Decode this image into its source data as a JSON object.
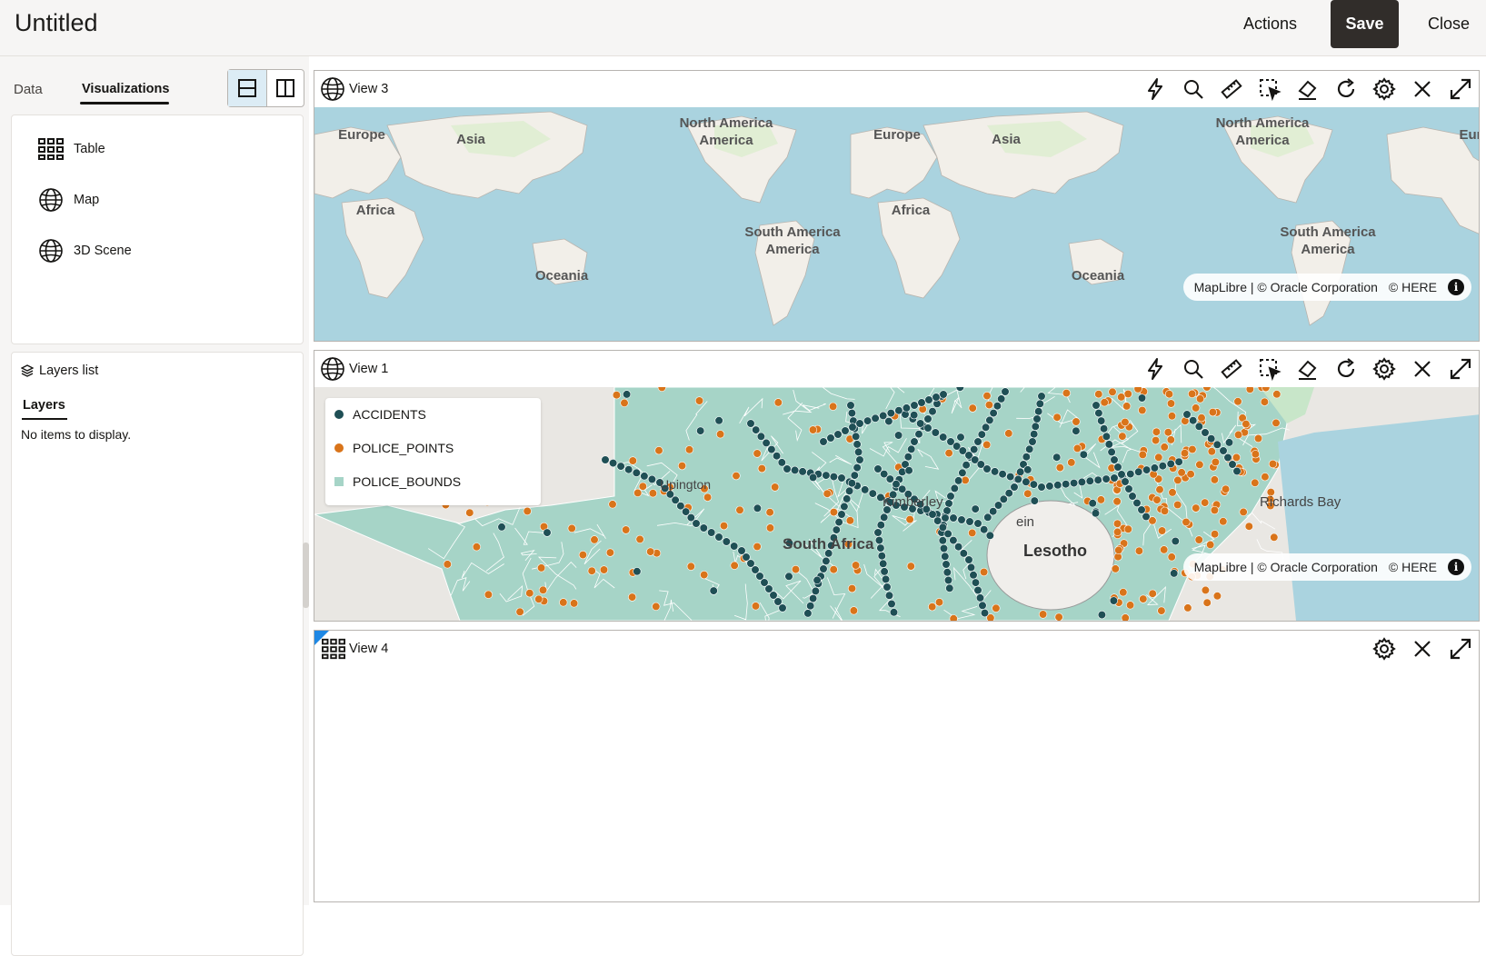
{
  "header": {
    "title": "Untitled",
    "actions_label": "Actions",
    "save_label": "Save",
    "close_label": "Close"
  },
  "left": {
    "tabs": [
      "Data",
      "Visualizations"
    ],
    "vis_items": [
      {
        "label": "Table",
        "icon": "table-icon"
      },
      {
        "label": "Map",
        "icon": "globe-icon"
      },
      {
        "label": "3D Scene",
        "icon": "globe-icon"
      }
    ],
    "layers": {
      "header": "Layers list",
      "tab": "Layers",
      "empty": "No items to display."
    }
  },
  "views": [
    {
      "title": "View 3",
      "icon": "globe-icon",
      "labels": [
        "Europe",
        "Asia",
        "North America",
        "Africa",
        "South America",
        "Oceania",
        "Europe",
        "Asia",
        "North America",
        "Africa",
        "South America",
        "Oceania",
        "Eur"
      ]
    },
    {
      "title": "View 1",
      "icon": "globe-icon",
      "legend": [
        {
          "label": "ACCIDENTS",
          "color": "#1f4f55"
        },
        {
          "label": "POLICE_POINTS",
          "color": "#d9741a"
        },
        {
          "label": "POLICE_BOUNDS",
          "color": "#a6d4c7"
        }
      ],
      "labels": [
        "Lesotho",
        "Richards Bay",
        "Kimberley",
        "South Africa",
        "Upington",
        "ein"
      ]
    },
    {
      "title": "View 4",
      "icon": "table-icon"
    }
  ],
  "attribution": {
    "text": "MapLibre | © Oracle Corporation",
    "here": "© HERE",
    "info": "i"
  },
  "colors": {
    "ocean": "#aad3df",
    "land": "#f2efe9",
    "accent": "#1e88e5",
    "accidents": "#1f4f55",
    "police": "#d9741a",
    "bounds": "#a6d4c7"
  }
}
